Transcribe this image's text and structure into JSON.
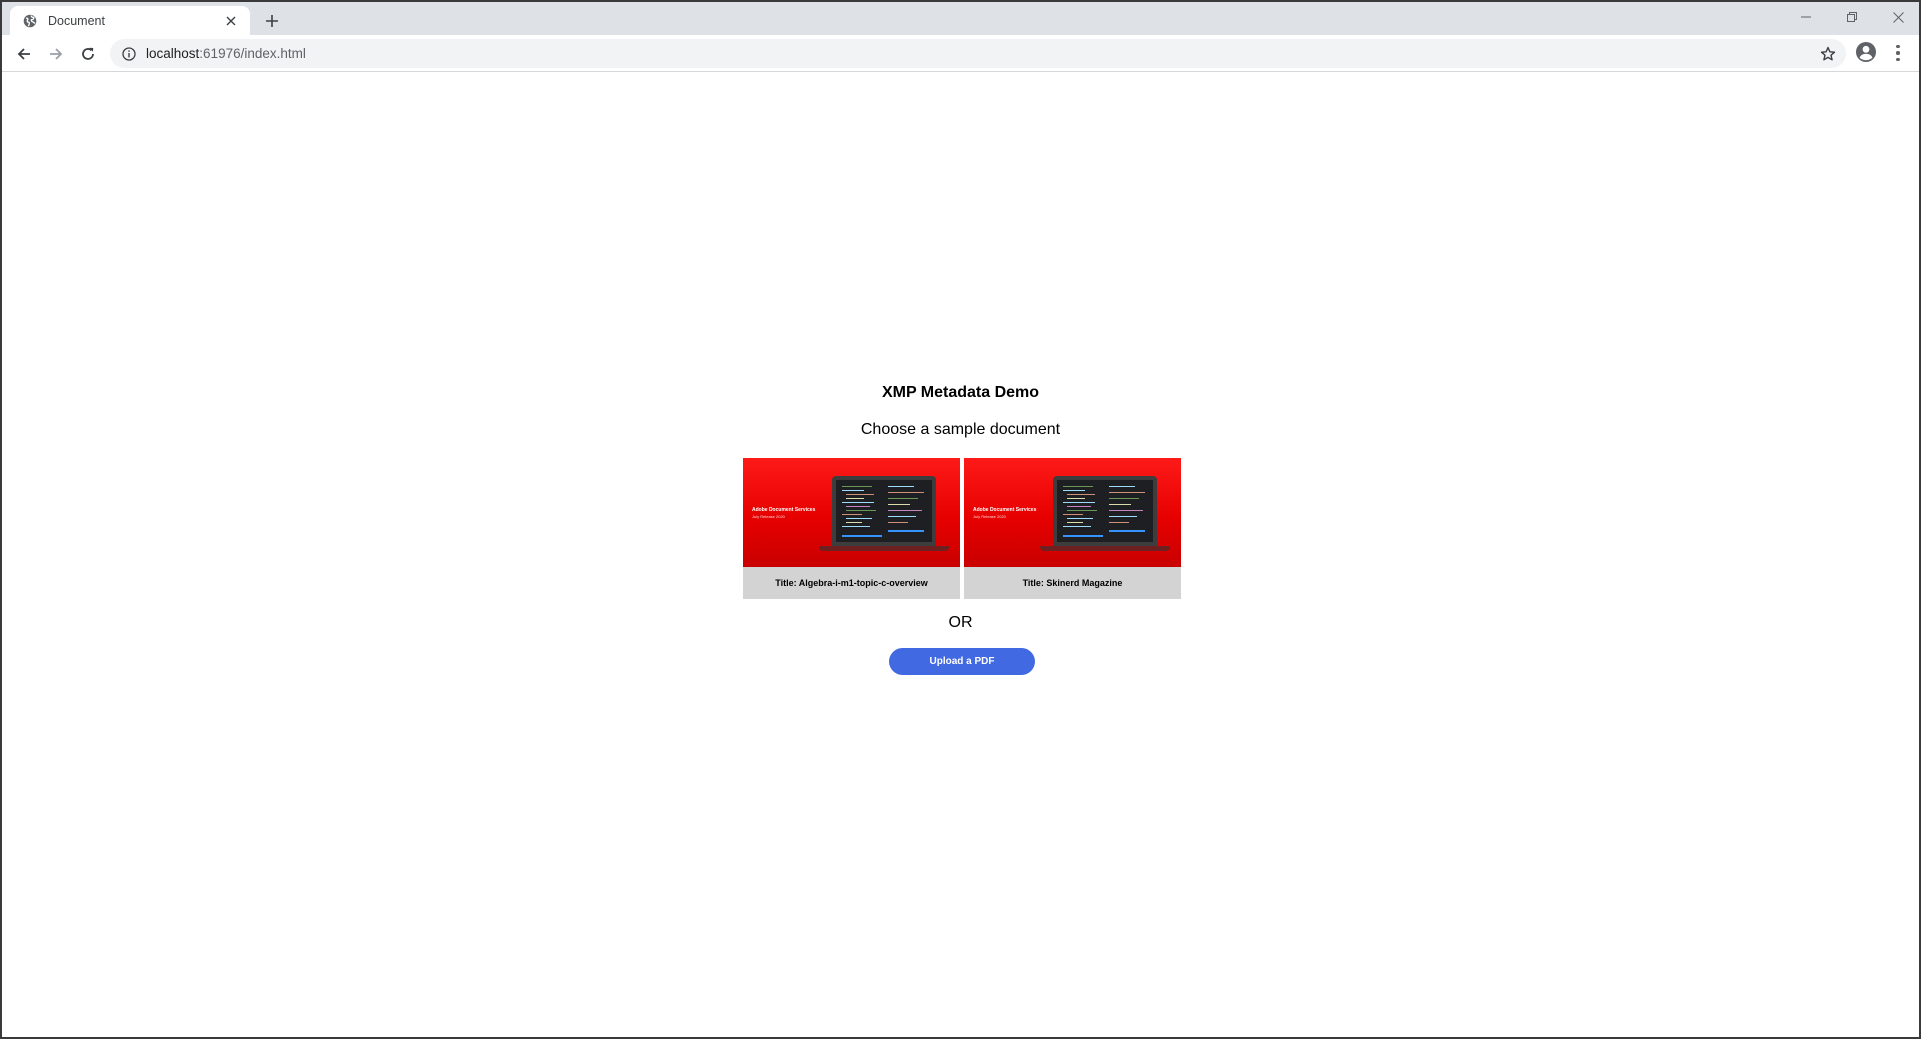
{
  "browser": {
    "tab_title": "Document",
    "url_host": "localhost",
    "url_rest": ":61976/index.html",
    "icons": {
      "favicon": "globe-icon",
      "tab_close": "close-icon",
      "new_tab": "plus-icon",
      "back": "arrow-left-icon",
      "forward": "arrow-right-icon",
      "reload": "reload-icon",
      "site_info": "info-icon",
      "bookmark": "star-icon",
      "profile": "profile-icon",
      "menu": "kebab-menu-icon"
    }
  },
  "page": {
    "title": "XMP Metadata Demo",
    "subtitle": "Choose a sample document",
    "or_text": "OR",
    "upload_label": "Upload a PDF",
    "upload_color": "#4169e1",
    "samples": [
      {
        "label": "Title: Algebra-i-m1-topic-c-overview",
        "thumb_brand": "Adobe Document Services",
        "thumb_sub": "July Release 2020"
      },
      {
        "label": "Title: Skinerd Magazine",
        "thumb_brand": "Adobe Document Services",
        "thumb_sub": "July Release 2020"
      }
    ]
  }
}
